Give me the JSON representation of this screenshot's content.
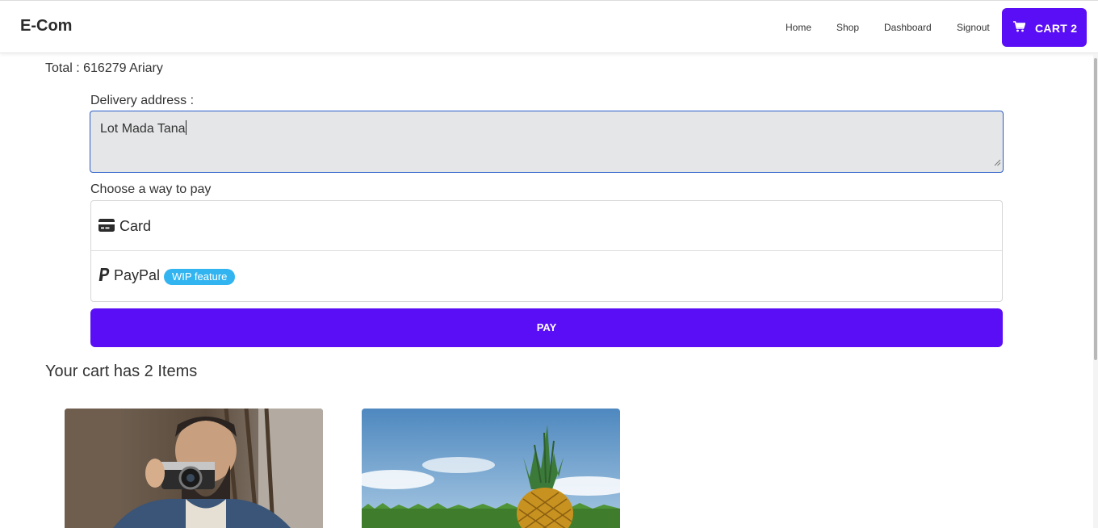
{
  "navbar": {
    "brand": "E-Com",
    "links": [
      "Home",
      "Shop",
      "Dashboard",
      "Signout"
    ],
    "cart_label": "CART 2",
    "cart_icon": "cart-icon"
  },
  "checkout": {
    "total": "Total : 616279 Ariary",
    "delivery_label": "Delivery address :",
    "delivery_value": "Lot Mada Tana",
    "pay_label": "Choose a way to pay",
    "options": [
      {
        "label": "Card",
        "icon": "credit-card-icon"
      },
      {
        "label": "PayPal",
        "icon": "paypal-icon",
        "badge": "WIP feature"
      }
    ],
    "pay_button": "PAY"
  },
  "cart": {
    "heading": "Your cart has 2 Items"
  },
  "colors": {
    "primary": "#5a0ef5",
    "badge": "#32b4f0",
    "focus_border": "#2a5dc9",
    "textarea_bg": "#e4e6e7"
  }
}
